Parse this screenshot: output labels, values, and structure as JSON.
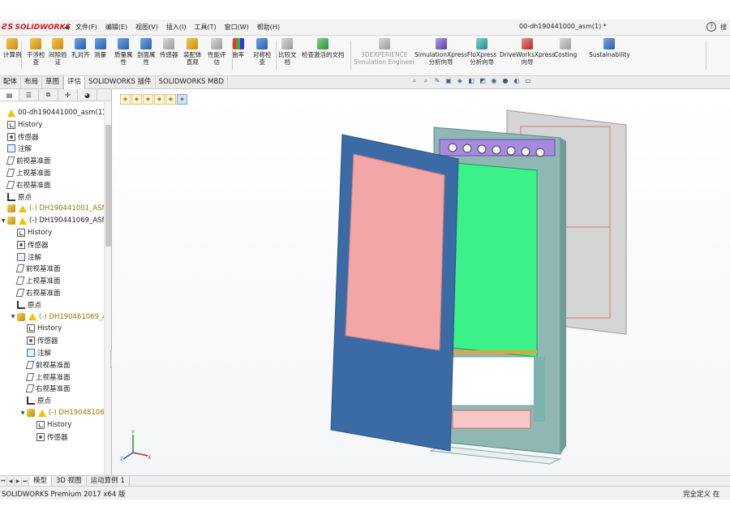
{
  "app": {
    "logo_text": "SOLIDWORKS",
    "menus": [
      "文件(F)",
      "编辑(E)",
      "视图(V)",
      "插入(I)",
      "工具(T)",
      "窗口(W)",
      "帮助(H)"
    ],
    "document_title": "00-dh190441000_asm(1) *",
    "search_label": "搜"
  },
  "ribbon": {
    "buttons": [
      {
        "label": "计算例",
        "icon": "calculator-icon"
      },
      {
        "label": "干涉检\n查",
        "icon": "interference-check-icon"
      },
      {
        "label": "间隙验\n证",
        "icon": "clearance-verification-icon"
      },
      {
        "label": "孔对齐",
        "icon": "hole-alignment-icon"
      },
      {
        "label": "测量",
        "icon": "measure-icon"
      },
      {
        "label": "质量属\n性",
        "icon": "mass-properties-icon"
      },
      {
        "label": "剖面属\n性",
        "icon": "section-properties-icon"
      },
      {
        "label": "传感器",
        "icon": "sensor-icon"
      },
      {
        "label": "装配体\n直观",
        "icon": "assembly-visualization-icon"
      },
      {
        "label": "性能评\n估",
        "icon": "performance-evaluation-icon"
      },
      {
        "label": "曲率",
        "icon": "curvature-icon"
      },
      {
        "label": "对称检\n查",
        "icon": "symmetry-check-icon"
      },
      {
        "label": "比较文\n档",
        "icon": "compare-documents-icon"
      },
      {
        "label": "检查激活的文档",
        "icon": "check-active-document-icon"
      },
      {
        "label": "3DEXPERIENCE\nSimulation Engineer",
        "icon": "3dexperience-icon"
      },
      {
        "label": "SimulationXpress\n分析向导",
        "icon": "simulationxpress-icon"
      },
      {
        "label": "FloXpress\n分析向导",
        "icon": "floxpress-icon"
      },
      {
        "label": "DriveWorksXpress\n向导",
        "icon": "driveworksxpress-icon"
      },
      {
        "label": "Costing",
        "icon": "costing-icon"
      },
      {
        "label": "Sustainability",
        "icon": "sustainability-icon"
      }
    ]
  },
  "command_tabs": [
    "配体",
    "布局",
    "草图",
    "评估",
    "SOLIDWORKS 插件",
    "SOLIDWORKS MBD"
  ],
  "active_command_tab": "评估",
  "tree": {
    "items": [
      {
        "label": "00-dh190441000_asm(1)  (",
        "icon": "warning-icon",
        "indent": 0
      },
      {
        "label": "History",
        "icon": "history-icon",
        "indent": 0
      },
      {
        "label": "传感器",
        "icon": "sensor-icon",
        "indent": 0
      },
      {
        "label": "注解",
        "icon": "annotations-icon",
        "indent": 0
      },
      {
        "label": "前视基准面",
        "icon": "plane-icon",
        "indent": 0
      },
      {
        "label": "上视基准面",
        "icon": "plane-icon",
        "indent": 0
      },
      {
        "label": "右视基准面",
        "icon": "plane-icon",
        "indent": 0
      },
      {
        "label": "原点",
        "icon": "origin-icon",
        "indent": 0
      },
      {
        "label": "(-) DH190441001_ASM",
        "icon": "assembly-icon",
        "indent": 0,
        "yellow": true
      },
      {
        "label": "(-) DH190441069_ASM",
        "icon": "assembly-icon",
        "indent": 0,
        "expanded": true
      },
      {
        "label": "History",
        "icon": "history-icon",
        "indent": 1
      },
      {
        "label": "传感器",
        "icon": "sensor-icon",
        "indent": 1
      },
      {
        "label": "注解",
        "icon": "annotations-icon",
        "indent": 1
      },
      {
        "label": "前视基准面",
        "icon": "plane-icon",
        "indent": 1
      },
      {
        "label": "上视基准面",
        "icon": "plane-icon",
        "indent": 1
      },
      {
        "label": "右视基准面",
        "icon": "plane-icon",
        "indent": 1
      },
      {
        "label": "原点",
        "icon": "origin-icon",
        "indent": 1
      },
      {
        "label": "(-) DH190461069_AS",
        "icon": "assembly-icon",
        "indent": 1,
        "yellow": true,
        "expanded": true
      },
      {
        "label": "History",
        "icon": "history-icon",
        "indent": 2
      },
      {
        "label": "传感器",
        "icon": "sensor-icon",
        "indent": 2
      },
      {
        "label": "注解",
        "icon": "annotations-icon",
        "indent": 2
      },
      {
        "label": "前视基准面",
        "icon": "plane-icon",
        "indent": 2
      },
      {
        "label": "上视基准面",
        "icon": "plane-icon",
        "indent": 2
      },
      {
        "label": "右视基准面",
        "icon": "plane-icon",
        "indent": 2
      },
      {
        "label": "原点",
        "icon": "origin-icon",
        "indent": 2
      },
      {
        "label": "(-) DH190481069",
        "icon": "assembly-icon",
        "indent": 2,
        "yellow": true,
        "expanded": true
      },
      {
        "label": "History",
        "icon": "history-icon",
        "indent": 3
      },
      {
        "label": "传感器",
        "icon": "sensor-icon",
        "indent": 3
      }
    ]
  },
  "model_tabs": [
    "模型",
    "3D 视图",
    "运动算例 1"
  ],
  "active_model_tab": "模型",
  "status": {
    "left": "SOLIDWORKS Premium 2017 x64 版",
    "right": "完全定义  在"
  },
  "colors": {
    "front_panel": "#3b6ba5",
    "front_screen": "#f2a6a6",
    "inner_screen": "#3cf08a",
    "frame": "#8fb7b3",
    "back_panel": "#d5d5d5",
    "logo": "#cc1f1f"
  }
}
